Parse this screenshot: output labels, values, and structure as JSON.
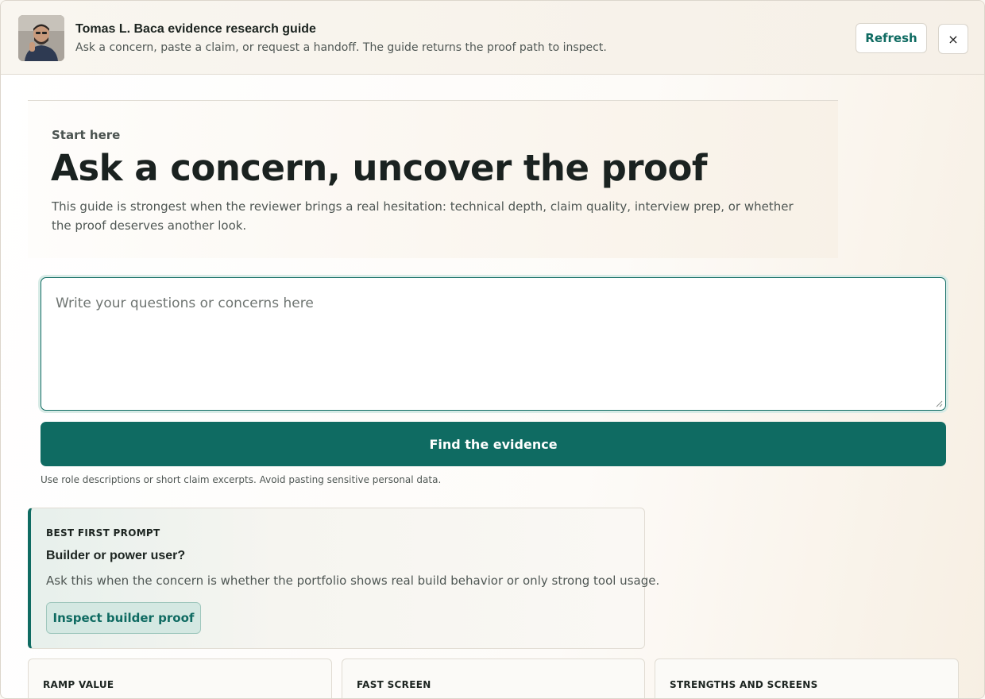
{
  "header": {
    "title": "Tomas L. Baca evidence research guide",
    "subtitle": "Ask a concern, paste a claim, or request a handoff. The guide returns the proof path to inspect.",
    "refresh_label": "Refresh",
    "close_label": "×"
  },
  "hero": {
    "eyebrow": "Start here",
    "title": "Ask a concern, uncover the proof",
    "description": "This guide is strongest when the reviewer brings a real hesitation: technical depth, claim quality, interview prep, or whether the proof deserves another look."
  },
  "input": {
    "placeholder": "Write your questions or concerns here",
    "value": ""
  },
  "submit_label": "Find the evidence",
  "hint": "Use role descriptions or short claim excerpts. Avoid pasting sensitive personal data.",
  "best_prompt": {
    "eyebrow": "BEST FIRST PROMPT",
    "title": "Builder or power user?",
    "description": "Ask this when the concern is whether the portfolio shows real build behavior or only strong tool usage.",
    "button_label": "Inspect builder proof"
  },
  "cards": [
    {
      "label": "RAMP VALUE"
    },
    {
      "label": "FAST SCREEN"
    },
    {
      "label": "STRENGTHS AND SCREENS"
    }
  ],
  "colors": {
    "accent": "#0f6b62",
    "accent_soft": "#d4e8e2"
  }
}
